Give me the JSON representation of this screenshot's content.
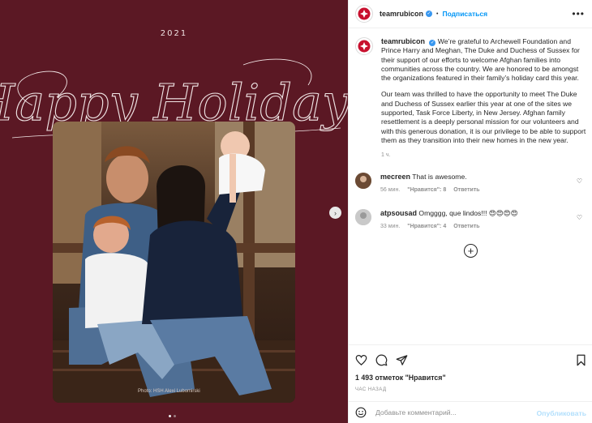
{
  "media": {
    "year": "2021",
    "script_title": "Happy Holidays",
    "photo_credit": "Photo: HSH Alexi Lubomirski",
    "slide_count": 2,
    "active_slide": 1,
    "background_color": "#5b1824"
  },
  "post": {
    "username": "teamrubicon",
    "verified": true,
    "follow_label": "Подписаться",
    "separator": "•",
    "more_icon": "more-horizontal-icon"
  },
  "caption": {
    "username": "teamrubicon",
    "paragraph1": "We’re grateful to Archewell Foundation and Prince Harry and Meghan, The Duke and Duchess of Sussex for their support of our efforts to welcome Afghan families into communities across the country. We are honored to be amongst the organizations featured in their family’s holiday card this year.",
    "paragraph2": "Our team was thrilled to have the opportunity to meet The Duke and Duchess of Sussex earlier this year at one of the sites we supported, Task Force Liberty, in New Jersey. Afghan family resettlement is a deeply personal mission for our volunteers and with this generous donation, it is our privilege to be able to support them as they transition into their new homes in the new year.",
    "time": "1 ч."
  },
  "comments": [
    {
      "username": "mecreen",
      "text": "That is awesome.",
      "time": "56 мин.",
      "likes": "\"Нравится\": 8",
      "reply": "Ответить"
    },
    {
      "username": "atpsousad",
      "text": "Omgggg, que lindos!!! 😍😍😍😍",
      "time": "33 мин.",
      "likes": "\"Нравится\": 4",
      "reply": "Ответить"
    }
  ],
  "footer": {
    "likes": "1 493 отметок \"Нравится\"",
    "posted": "ЧАС НАЗАД",
    "comment_placeholder": "Добавьте комментарий...",
    "publish_label": "Опубликовать"
  },
  "colors": {
    "accent": "#0095f6",
    "brand_red": "#c8102e",
    "publish_disabled": "#b2dffc"
  }
}
